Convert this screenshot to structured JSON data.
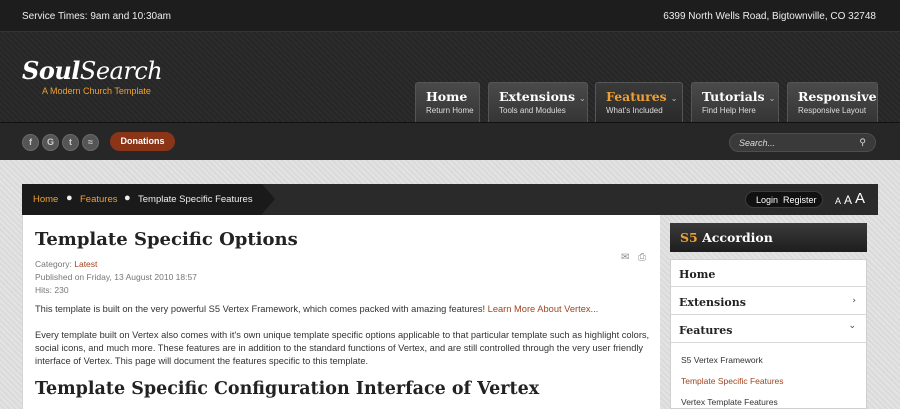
{
  "topbar": {
    "service_times": "Service Times: 9am and 10:30am",
    "address": "6399 North Wells Road, Bigtownville, CO 32748"
  },
  "brand": {
    "logo_bold": "Soul",
    "logo_rest": "Search",
    "tagline": "A Modern Church Template"
  },
  "nav": [
    {
      "title": "Home",
      "subtitle": "Return Home",
      "has_dropdown": false
    },
    {
      "title": "Extensions",
      "subtitle": "Tools and Modules",
      "has_dropdown": true
    },
    {
      "title": "Features",
      "subtitle": "What's Included",
      "has_dropdown": true,
      "active": true
    },
    {
      "title": "Tutorials",
      "subtitle": "Find Help Here",
      "has_dropdown": true
    },
    {
      "title": "Responsive",
      "subtitle": "Responsive Layout",
      "has_dropdown": false
    }
  ],
  "social": [
    {
      "icon": "facebook-icon",
      "glyph": "f"
    },
    {
      "icon": "google-icon",
      "glyph": "G"
    },
    {
      "icon": "twitter-icon",
      "glyph": "t"
    },
    {
      "icon": "rss-icon",
      "glyph": "≈"
    }
  ],
  "donate_label": "Donations",
  "search": {
    "placeholder": "Search...",
    "icon": "search-icon"
  },
  "breadcrumb": {
    "home": "Home",
    "section": "Features",
    "current": "Template Specific Features",
    "separator": "●"
  },
  "account": {
    "login": "Login",
    "register": "Register"
  },
  "font_size_controls": [
    "A",
    "A",
    "A"
  ],
  "article": {
    "title": "Template Specific Options",
    "category_label": "Category:",
    "category_value": "Latest",
    "published": "Published on Friday, 13 August 2010 18:57",
    "hits": "Hits: 230",
    "intro": "This template is built on the very powerful S5 Vertex Framework, which comes packed with amazing features!",
    "intro_link": "Learn More About Vertex...",
    "body": "Every template built on Vertex also comes with it's own unique template specific options applicable to that particular template such as highlight colors, social icons, and much more. These features are in addition to the standard functions of Vertex, and are still controlled through the very user friendly interface of Vertex. This page will document the features specific to this template.",
    "subheading": "Template Specific Configuration Interface of Vertex",
    "tools": {
      "email_icon": "email-icon",
      "print_icon": "print-icon"
    }
  },
  "sidebar": {
    "title_accent": "S5",
    "title_rest": "Accordion",
    "items": [
      {
        "label": "Home",
        "chevron": ""
      },
      {
        "label": "Extensions",
        "chevron": "›"
      },
      {
        "label": "Features",
        "chevron": "⌄"
      }
    ],
    "subitems": [
      {
        "label": "S5 Vertex Framework",
        "active": false
      },
      {
        "label": "Template Specific Features",
        "active": true
      },
      {
        "label": "Vertex Template Features",
        "active": false
      }
    ]
  },
  "colors": {
    "accent_orange": "#f0a030",
    "link_rust": "#a0441e",
    "donate_bg": "#8b3518",
    "dark_bg": "#1d1d1d"
  }
}
